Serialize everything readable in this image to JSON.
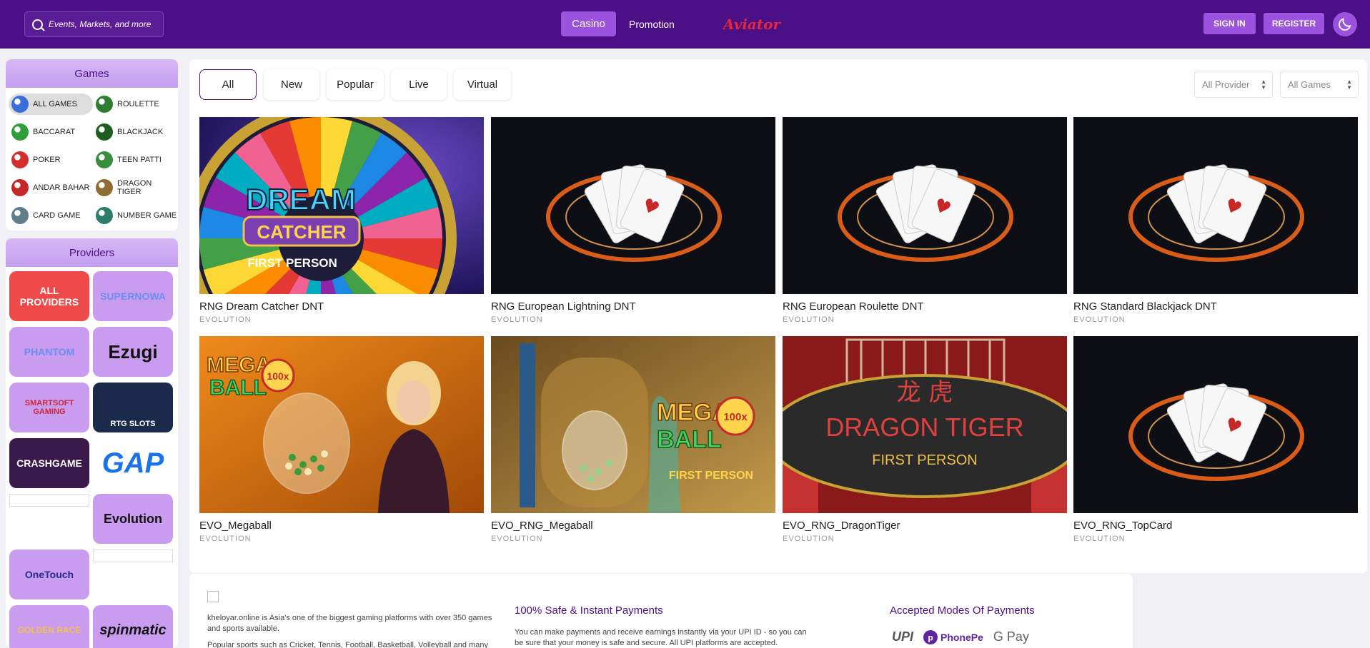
{
  "header": {
    "search_placeholder": "Events, Markets, and more",
    "nav": {
      "casino": "Casino",
      "promotion": "Promotion",
      "aviator": "Aviator"
    },
    "sign_in": "SIGN IN",
    "register": "REGISTER",
    "theme_icon": "moon-icon"
  },
  "sidebar": {
    "games_title": "Games",
    "categories": [
      {
        "label": "ALL GAMES",
        "icon": "all-games-icon",
        "color": "#3b6fd8"
      },
      {
        "label": "ROULETTE",
        "icon": "roulette-icon",
        "color": "#2e7d32"
      },
      {
        "label": "BACCARAT",
        "icon": "baccarat-icon",
        "color": "#2e9d3a"
      },
      {
        "label": "BLACKJACK",
        "icon": "blackjack-icon",
        "color": "#1b5e20"
      },
      {
        "label": "POKER",
        "icon": "poker-chip-icon",
        "color": "#d32f2f"
      },
      {
        "label": "TEEN PATTI",
        "icon": "teen-patti-icon",
        "color": "#388e3c"
      },
      {
        "label": "ANDAR BAHAR",
        "icon": "andar-bahar-icon",
        "color": "#c62828"
      },
      {
        "label": "DRAGON TIGER",
        "icon": "dragon-tiger-icon",
        "color": "#8d6e30"
      },
      {
        "label": "CARD GAME",
        "icon": "card-game-icon",
        "color": "#607d8b"
      },
      {
        "label": "NUMBER GAME",
        "icon": "number-game-icon",
        "color": "#2e7d6b"
      }
    ],
    "providers_title": "Providers",
    "providers": [
      {
        "label": "ALL PROVIDERS",
        "bg": "#ef4a4a"
      },
      {
        "label": "SUPERNOWA",
        "bg": "#c99cf0"
      },
      {
        "label": "PHANTOM",
        "bg": "#c99cf0"
      },
      {
        "label": "Ezugi",
        "bg": "#c99cf0"
      },
      {
        "label": "SMARTSOFT GAMING",
        "bg": "#c99cf0"
      },
      {
        "label": "RTG SLOTS",
        "bg": "#1a2a4a"
      },
      {
        "label": "CRASHGAME",
        "bg": "#3a1a4a"
      },
      {
        "label": "GAP",
        "bg": "#ffffff"
      },
      {
        "label": "",
        "bg": "#ffffff"
      },
      {
        "label": "Evolution",
        "bg": "#c99cf0"
      },
      {
        "label": "OneTouch",
        "bg": "#c99cf0"
      },
      {
        "label": "",
        "bg": "#ffffff"
      },
      {
        "label": "GOLDEN RACE",
        "bg": "#c99cf0"
      },
      {
        "label": "spinmatic",
        "bg": "#c99cf0"
      }
    ]
  },
  "filters": {
    "tabs": [
      "All",
      "New",
      "Popular",
      "Live",
      "Virtual"
    ],
    "provider_select": "All Provider",
    "games_select": "All Games"
  },
  "games": [
    {
      "name": "RNG Dream Catcher DNT",
      "provider": "EVOLUTION",
      "thumb": "dream-catcher"
    },
    {
      "name": "RNG European Lightning DNT",
      "provider": "EVOLUTION",
      "thumb": "cards"
    },
    {
      "name": "RNG European Roulette DNT",
      "provider": "EVOLUTION",
      "thumb": "cards"
    },
    {
      "name": "RNG Standard Blackjack DNT",
      "provider": "EVOLUTION",
      "thumb": "cards"
    },
    {
      "name": "EVO_Megaball",
      "provider": "EVOLUTION",
      "thumb": "megaball-host"
    },
    {
      "name": "EVO_RNG_Megaball",
      "provider": "EVOLUTION",
      "thumb": "megaball"
    },
    {
      "name": "EVO_RNG_DragonTiger",
      "provider": "EVOLUTION",
      "thumb": "dragon-tiger"
    },
    {
      "name": "EVO_RNG_TopCard",
      "provider": "EVOLUTION",
      "thumb": "cards"
    }
  ],
  "thumb_text": {
    "dream": "DREAM",
    "catcher": "CATCHER",
    "first_person": "FIRST PERSON",
    "mega": "MEGA",
    "ball": "BALL",
    "badge": "100x",
    "dragon_tiger": "DRAGON TIGER",
    "chinese": "龙 虎"
  },
  "footer": {
    "about": "kheloyar.online is Asia's one of the biggest gaming platforms with over 350 games and sports available.",
    "about2": "Popular sports such as Cricket, Tennis, Football, Basketball, Volleyball and many",
    "payments_title": "100% Safe & Instant Payments",
    "payments_text": "You can make payments and receive earnings instantly via your UPI ID - so you can be sure that your money is safe and secure. All UPI platforms are accepted.",
    "modes_title": "Accepted Modes Of Payments",
    "modes": [
      "UPI",
      "PhonePe",
      "G Pay"
    ]
  }
}
